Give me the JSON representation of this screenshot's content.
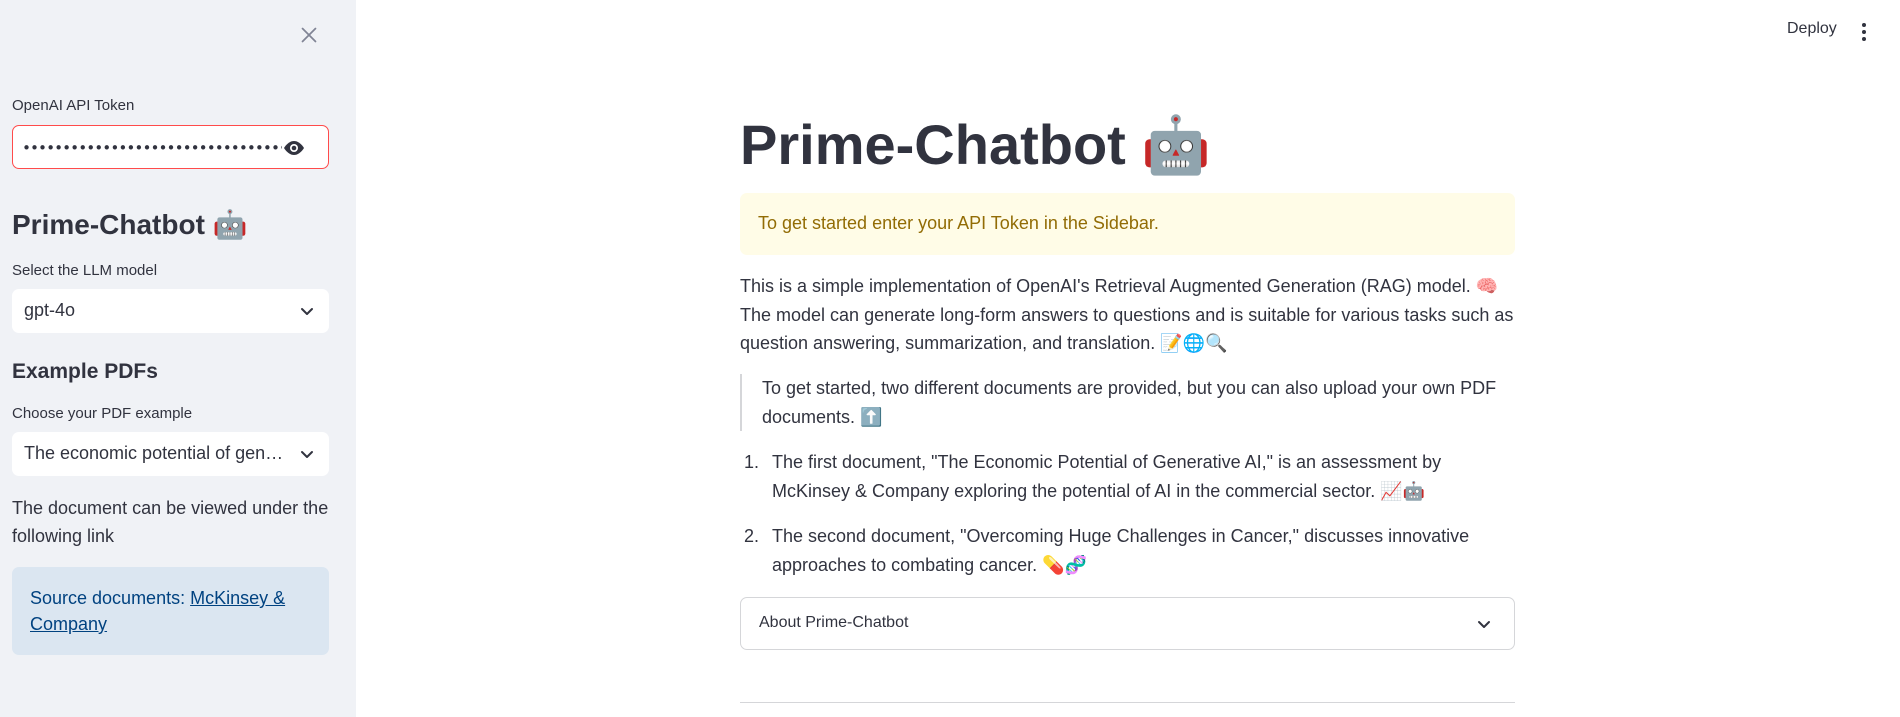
{
  "sidebar": {
    "token_label": "OpenAI API Token",
    "token_value": "••••••••••••••••••••••••••••••••••••••••••••••••",
    "title": "Prime-Chatbot 🤖",
    "model_label": "Select the LLM model",
    "model_value": "gpt-4o",
    "examples_heading": "Example PDFs",
    "pdf_label": "Choose your PDF example",
    "pdf_value": "The economic potential of generative AI",
    "doc_note": "The document can be viewed under the following link",
    "source_prefix": "Source documents: ",
    "source_link": "McKinsey & Company"
  },
  "header": {
    "deploy_label": "Deploy"
  },
  "main": {
    "title": "Prime-Chatbot 🤖",
    "warning": "To get started enter your API Token in the Sidebar.",
    "intro": "This is a simple implementation of OpenAI's Retrieval Augmented Generation (RAG) model. 🧠 The model can generate long-form answers to questions and is suitable for various tasks such as question answering, summarization, and translation. 📝🌐🔍",
    "quote": "To get started, two different documents are provided, but you can also upload your own PDF documents. ⬆️",
    "list": [
      {
        "num": "1.",
        "text": "The first document, \"The Economic Potential of Generative AI,\" is an assessment by McKinsey & Company exploring the potential of AI in the commercial sector. 📈🤖"
      },
      {
        "num": "2.",
        "text": "The second document, \"Overcoming Huge Challenges in Cancer,\" discusses innovative approaches to combating cancer. 💊🧬"
      }
    ],
    "expander_label": "About Prime-Chatbot"
  },
  "colors": {
    "sidebar_bg": "#f0f2f6",
    "input_error_border": "#ff4b4b",
    "warning_bg": "#fffce7",
    "warning_text": "#926c05",
    "info_bg": "#dbe6f1",
    "info_text": "#004280"
  },
  "icons": [
    "close-icon",
    "eye-icon",
    "chevron-down-icon",
    "kebab-menu-icon"
  ]
}
